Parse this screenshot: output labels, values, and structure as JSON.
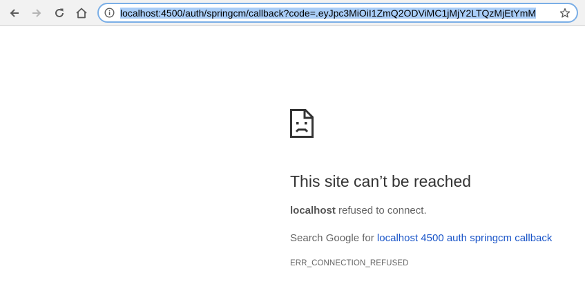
{
  "browser": {
    "address_bar": {
      "url": "localhost:4500/auth/springcm/callback?code=.eyJpc3MiOiI1ZmQ2ODViMC1jMjY2LTQzMjEtYmM"
    },
    "icons": {
      "back": "back-arrow-icon",
      "forward": "forward-arrow-icon",
      "reload": "reload-icon",
      "home": "home-icon",
      "info": "info-icon",
      "bookmark": "star-icon"
    }
  },
  "error_page": {
    "icon": "sad-document-icon",
    "title": "This site can’t be reached",
    "host": "localhost",
    "message_suffix": "refused to connect.",
    "search_prefix": "Search Google for",
    "search_link": "localhost 4500 auth springcm callback",
    "error_code": "ERR_CONNECTION_REFUSED"
  },
  "colors": {
    "link": "#1a55c8",
    "omnibox_border": "#7aaee6",
    "selection": "#a9cdf7"
  }
}
